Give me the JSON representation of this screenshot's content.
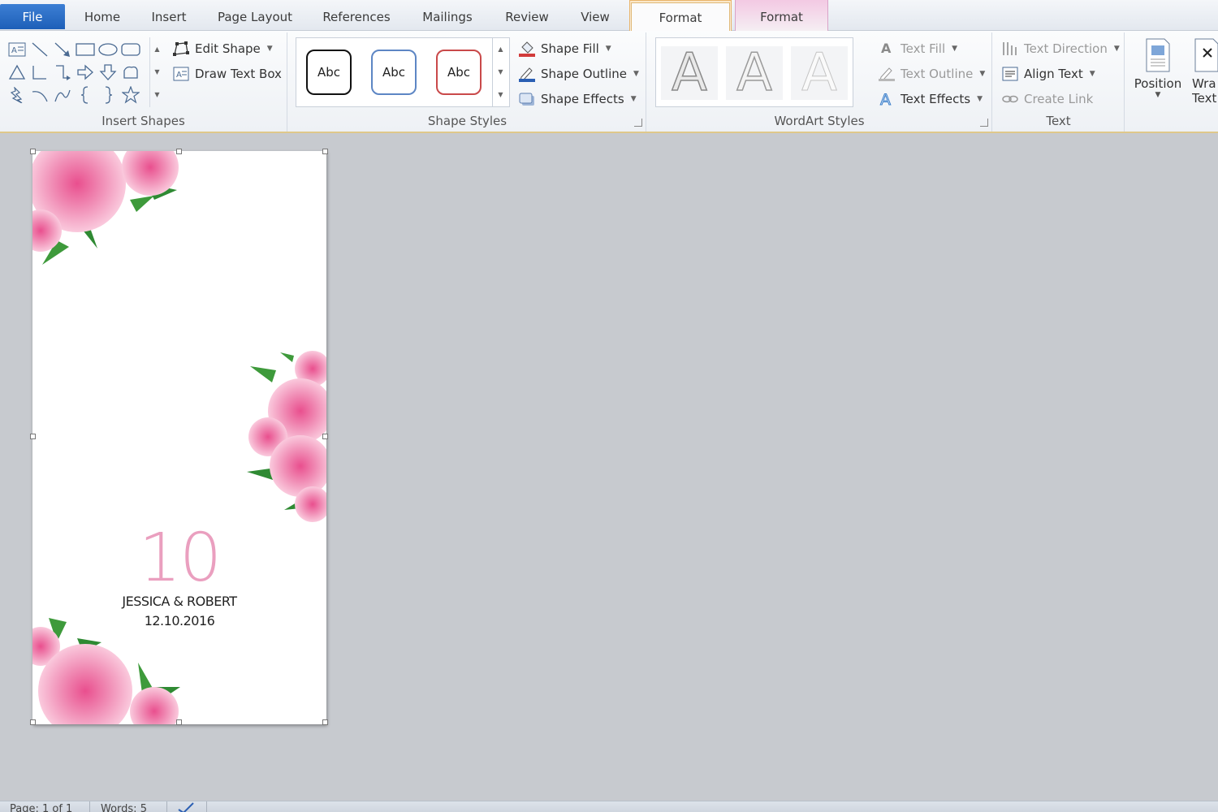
{
  "tabs": {
    "file": "File",
    "home": "Home",
    "insert": "Insert",
    "page_layout": "Page Layout",
    "references": "References",
    "mailings": "Mailings",
    "review": "Review",
    "view": "View",
    "format_drawing": "Format",
    "format_picture": "Format"
  },
  "ribbon": {
    "insert_shapes": {
      "label": "Insert Shapes",
      "edit_shape": "Edit Shape",
      "draw_text_box": "Draw Text Box"
    },
    "shape_styles": {
      "label": "Shape Styles",
      "preset_1": "Abc",
      "preset_2": "Abc",
      "preset_3": "Abc",
      "shape_fill": "Shape Fill",
      "shape_outline": "Shape Outline",
      "shape_effects": "Shape Effects"
    },
    "wordart_styles": {
      "label": "WordArt Styles",
      "preset_1": "A",
      "preset_2": "A",
      "preset_3": "A",
      "text_fill": "Text Fill",
      "text_outline": "Text Outline",
      "text_effects": "Text Effects"
    },
    "text": {
      "label": "Text",
      "text_direction": "Text Direction",
      "align_text": "Align Text",
      "create_link": "Create Link"
    },
    "arrange": {
      "position": "Position",
      "wrap_text_1": "Wra",
      "wrap_text_2": "Text"
    }
  },
  "document": {
    "table_number": "10",
    "names": "JESSICA & ROBERT",
    "date": "12.10.2016"
  },
  "status": {
    "page": "Page: 1 of 1",
    "words": "Words: 5"
  },
  "colors": {
    "accent_pink": "#ea9fbf",
    "file_tab": "#2a6cc6",
    "context_orange": "#e9b46a",
    "context_pink": "#d9a3c8"
  }
}
